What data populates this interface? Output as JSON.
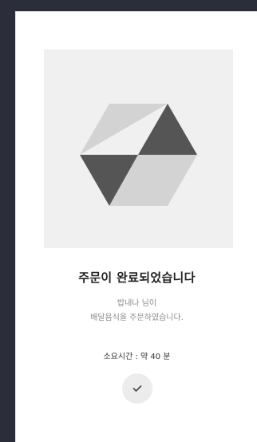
{
  "order_complete": {
    "illustration_icon": "hexagon-cube-icon",
    "title": "주문이 완료되었습니다",
    "message_line1": "밥내나 님이",
    "message_line2": "배달음식을 주문하였습니다.",
    "eta": "소요시간 : 약 40 분",
    "confirm_icon": "check-icon"
  },
  "colors": {
    "background": "#2b2d3a",
    "card": "#ffffff",
    "illustration_bg": "#f0f0f0",
    "hex_light": "#d3d3d3",
    "hex_dark": "#555555",
    "title_text": "#222222",
    "muted_text": "#8c8c8c",
    "button_bg": "#ececec"
  }
}
